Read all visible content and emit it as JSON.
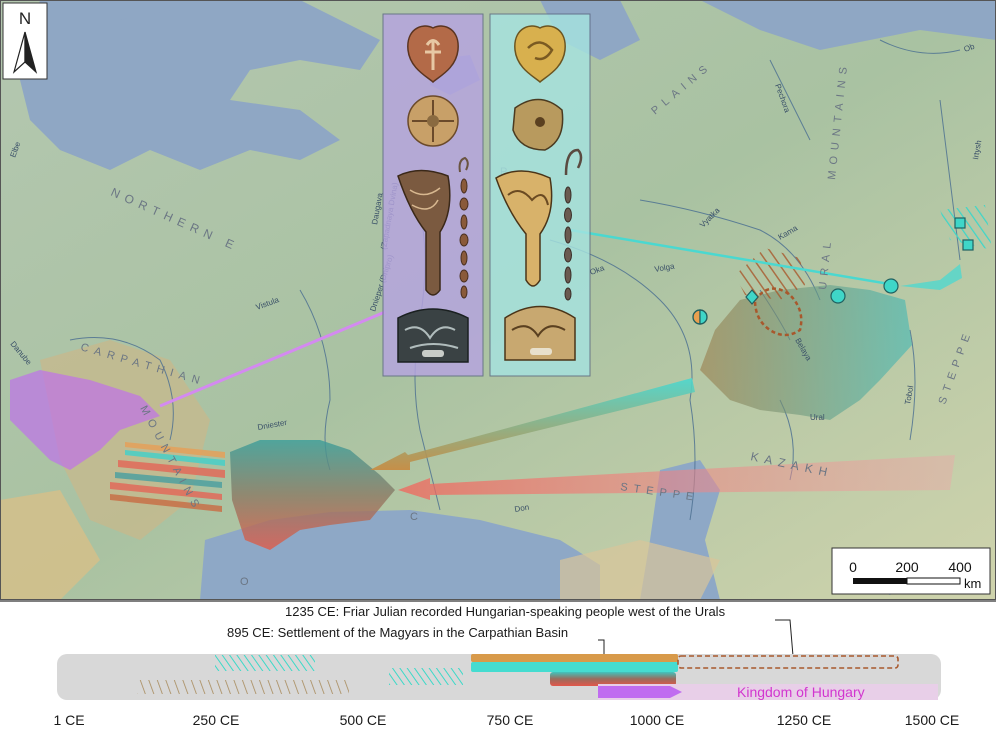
{
  "north_arrow": {
    "label": "N"
  },
  "scale_bar": {
    "ticks": [
      "0",
      "200",
      "400"
    ],
    "unit": "km"
  },
  "region_labels": [
    {
      "text": "NORTHERN E",
      "name": "label-northern-e"
    },
    {
      "text": "CARPATHIAN",
      "name": "label-carpathian"
    },
    {
      "text": "MOUNTAINS",
      "name": "label-carpathian-mountains"
    },
    {
      "text": "URAL",
      "name": "label-ural"
    },
    {
      "text": "MOUNTAINS",
      "name": "label-ural-mountains"
    },
    {
      "text": "PLAINS",
      "name": "label-plains"
    },
    {
      "text": "STEPPE",
      "name": "label-steppe-east"
    },
    {
      "text": "KAZAKH",
      "name": "label-kazakh"
    },
    {
      "text": "STEPPE",
      "name": "label-steppe-south"
    },
    {
      "text": "P",
      "name": "label-p"
    },
    {
      "text": "C",
      "name": "label-c"
    },
    {
      "text": "O",
      "name": "label-o"
    }
  ],
  "rivers": [
    {
      "text": "Elbe",
      "name": "river-elbe"
    },
    {
      "text": "Vistula",
      "name": "river-vistula"
    },
    {
      "text": "Danube",
      "name": "river-danube"
    },
    {
      "text": "Dniester",
      "name": "river-dniester"
    },
    {
      "text": "Dnieper (Dnipro)",
      "name": "river-dnieper"
    },
    {
      "text": "Daugava",
      "name": "river-daugava"
    },
    {
      "text": "(Zapadnaya Dvina)",
      "name": "river-zapadnaya-dvina"
    },
    {
      "text": "Volga",
      "name": "river-volga"
    },
    {
      "text": "Oka",
      "name": "river-oka"
    },
    {
      "text": "Vyatka",
      "name": "river-vyatka"
    },
    {
      "text": "Kama",
      "name": "river-kama"
    },
    {
      "text": "Belaya",
      "name": "river-belaya"
    },
    {
      "text": "Ural",
      "name": "river-ural"
    },
    {
      "text": "Tobol",
      "name": "river-tobol"
    },
    {
      "text": "Irtysh",
      "name": "river-irtysh"
    },
    {
      "text": "Pechora",
      "name": "river-pechora"
    },
    {
      "text": "Ob",
      "name": "river-ob"
    },
    {
      "text": "Don",
      "name": "river-don"
    }
  ],
  "timeline": {
    "annotations": [
      "1235 CE: Friar Julian recorded Hungarian-speaking people west of the Urals",
      "895 CE: Settlement of the Magyars in the Carpathian Basin"
    ],
    "kingdom_label": "Kingdom of Hungary",
    "ticks": [
      "1 CE",
      "250 CE",
      "500 CE",
      "750 CE",
      "1000 CE",
      "1250 CE",
      "1500 CE"
    ]
  },
  "colors": {
    "cyan": "#45dcd0",
    "orange": "#d8904a",
    "brown": "#a8582c",
    "red": "#ee6050",
    "violet": "#c06cf0",
    "magenta_text": "#d236cf",
    "panel_violet": "#b6a4e0",
    "panel_cyan": "#a6e3e0"
  }
}
